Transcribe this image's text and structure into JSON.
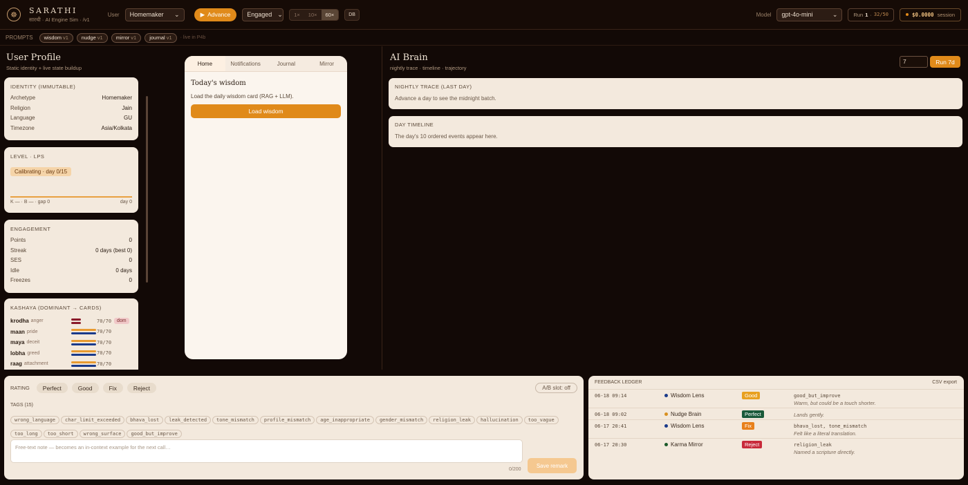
{
  "app": {
    "title": "SARATHI",
    "subtitle": "सारथी · AI Engine Sim · /v1"
  },
  "topbar": {
    "user_label": "User",
    "user_value": "Homemaker",
    "advance_label": "Advance",
    "engaged_value": "Engaged",
    "speeds": [
      "1×",
      "10×",
      "60×"
    ],
    "speed_selected": "60×",
    "db_label": "DB",
    "model_label": "Model",
    "model_value": "gpt-4o-mini",
    "run_label": "Run",
    "run_number": "1",
    "run_progress": "32/50",
    "cost_value": "$0.0000",
    "cost_label": "session"
  },
  "prompts": {
    "label": "PROMPTS",
    "items": [
      {
        "name": "wisdom",
        "version": "v1"
      },
      {
        "name": "nudge",
        "version": "v1"
      },
      {
        "name": "mirror",
        "version": "v1"
      },
      {
        "name": "journal",
        "version": "v1"
      }
    ],
    "status": "· live in P4b"
  },
  "profile": {
    "title": "User Profile",
    "subtitle": "Static identity + live state buildup",
    "identity": {
      "title": "IDENTITY (IMMUTABLE)",
      "rows": [
        {
          "k": "Archetype",
          "v": "Homemaker"
        },
        {
          "k": "Religion",
          "v": "Jain"
        },
        {
          "k": "Language",
          "v": "GU"
        },
        {
          "k": "Timezone",
          "v": "Asia/Kolkata"
        }
      ]
    },
    "level": {
      "title": "LEVEL · LPS",
      "badge": "Calibrating · day 0/15",
      "footer_left": "K — · B — · gap 0",
      "footer_right": "day 0"
    },
    "engagement": {
      "title": "ENGAGEMENT",
      "rows": [
        {
          "k": "Points",
          "v": "0"
        },
        {
          "k": "Streak",
          "v": "0 days (best 0)"
        },
        {
          "k": "SES",
          "v": "0"
        },
        {
          "k": "Idle",
          "v": "0 days"
        },
        {
          "k": "Freezes",
          "v": "0"
        }
      ]
    },
    "kashaya": {
      "title": "KASHAYA (DOMINANT → CARDS)",
      "rows": [
        {
          "name": "krodha",
          "sub": "anger",
          "value": "70/70",
          "dominant": true,
          "fill": 0.3
        },
        {
          "name": "maan",
          "sub": "pride",
          "value": "70/70",
          "dominant": false,
          "fill": 0.7
        },
        {
          "name": "maya",
          "sub": "deceit",
          "value": "70/70",
          "dominant": false,
          "fill": 0.7
        },
        {
          "name": "lobha",
          "sub": "greed",
          "value": "70/70",
          "dominant": false,
          "fill": 0.7
        },
        {
          "name": "raag",
          "sub": "attachment",
          "value": "70/70",
          "dominant": false,
          "fill": 0.7
        }
      ],
      "dom_label": "dom"
    }
  },
  "phone": {
    "tabs": [
      "Home",
      "Notifications",
      "Journal",
      "Mirror"
    ],
    "active_tab": "Home",
    "heading": "Today's wisdom",
    "text": "Load the daily wisdom card (RAG + LLM).",
    "button": "Load wisdom"
  },
  "brain": {
    "title": "AI Brain",
    "subtitle": "nightly trace · timeline · trajectory",
    "days_value": "7",
    "run_button": "Run 7d",
    "nightly": {
      "title": "NIGHTLY TRACE (LAST DAY)",
      "body": "Advance a day to see the midnight batch."
    },
    "timeline": {
      "title": "DAY TIMELINE",
      "body": "The day's 10 ordered events appear here."
    }
  },
  "rating": {
    "label": "RATING",
    "buttons": [
      "Perfect",
      "Good",
      "Fix",
      "Reject"
    ],
    "ab_slot": "A/B slot: off",
    "tags_label": "TAGS (15)",
    "tags": [
      "wrong_language",
      "char_limit_exceeded",
      "bhava_lost",
      "leak_detected",
      "tone_mismatch",
      "profile_mismatch",
      "age_inappropriate",
      "gender_mismatch",
      "religion_leak",
      "hallucination",
      "too_vague",
      "too_long",
      "too_short",
      "wrong_surface",
      "good_but_improve"
    ],
    "note_placeholder": "Free-text note — becomes an in-context example for the next call…",
    "counter": "0/200",
    "save_button": "Save remark"
  },
  "ledger": {
    "title": "FEEDBACK LEDGER",
    "export": "CSV export",
    "rows": [
      {
        "date": "06-18 09:14",
        "source": "Wisdom Lens",
        "dot": "#1a3a8a",
        "badge": "Good",
        "badge_color": "#e8a020",
        "tags": "good_but_improve",
        "comment": "Warm, but could be a touch shorter."
      },
      {
        "date": "06-18 09:02",
        "source": "Nudge Brain",
        "dot": "#d89020",
        "badge": "Perfect",
        "badge_color": "#1a5a3a",
        "tags": "",
        "comment": "Lands gently."
      },
      {
        "date": "06-17 20:41",
        "source": "Wisdom Lens",
        "dot": "#1a3a8a",
        "badge": "Fix",
        "badge_color": "#e8801a",
        "tags": "bhava_lost, tone_mismatch",
        "comment": "Felt like a literal translation."
      },
      {
        "date": "06-17 20:30",
        "source": "Karma Mirror",
        "dot": "#1a5a2a",
        "badge": "Reject",
        "badge_color": "#c82a3a",
        "tags": "religion_leak",
        "comment": "Named a scripture directly."
      }
    ]
  },
  "colors": {
    "accent": "#e08a1a",
    "bg": "#120906",
    "card": "#f3e9dd"
  }
}
